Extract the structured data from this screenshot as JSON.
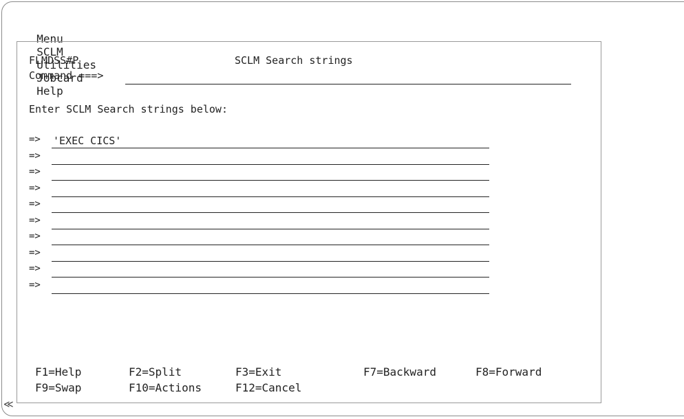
{
  "menubar": {
    "items": [
      "Menu",
      "SCLM",
      "Utilities",
      "Jobcard",
      "Help"
    ]
  },
  "panel": {
    "panel_id": "FLMDSS#P",
    "title": "SCLM Search strings",
    "command_label": "Command ===>",
    "command_value": "",
    "instruction": "Enter SCLM Search strings below:",
    "prompt": "=>",
    "search_strings": [
      "'EXEC CICS'",
      "",
      "",
      "",
      "",
      "",
      "",
      "",
      "",
      ""
    ]
  },
  "function_keys": {
    "row1": [
      "F1=Help",
      "F2=Split",
      "F3=Exit",
      "F7=Backward",
      "F8=Forward"
    ],
    "row2": [
      "F9=Swap",
      "F10=Actions",
      "F12=Cancel"
    ]
  },
  "corner_glyph": "≪"
}
